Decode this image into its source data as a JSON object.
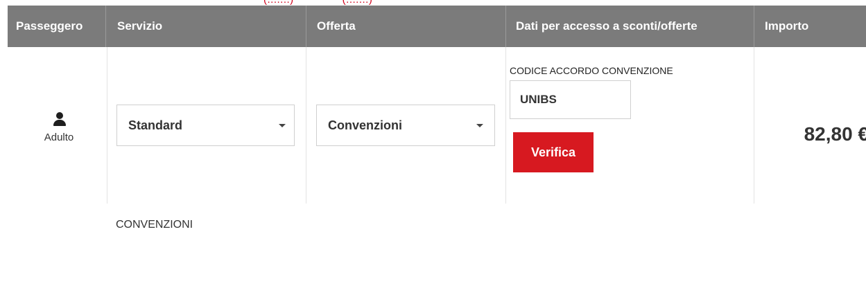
{
  "header": {
    "passenger": "Passeggero",
    "service": "Servizio",
    "offer": "Offerta",
    "discount_data": "Dati per accesso a sconti/offerte",
    "amount": "Importo"
  },
  "passenger": {
    "icon": "user-icon",
    "type": "Adulto"
  },
  "service_select": {
    "value": "Standard"
  },
  "offer_select": {
    "value": "Convenzioni"
  },
  "discount": {
    "code_label": "CODICE ACCORDO CONVENZIONE",
    "code_value": "UNIBS",
    "verify_label": "Verifica"
  },
  "amount": "82,80 €",
  "footer_label": "CONVENZIONI",
  "colors": {
    "header_bg": "#7b7b7b",
    "accent": "#d71920",
    "top_text": "#d0021b"
  }
}
